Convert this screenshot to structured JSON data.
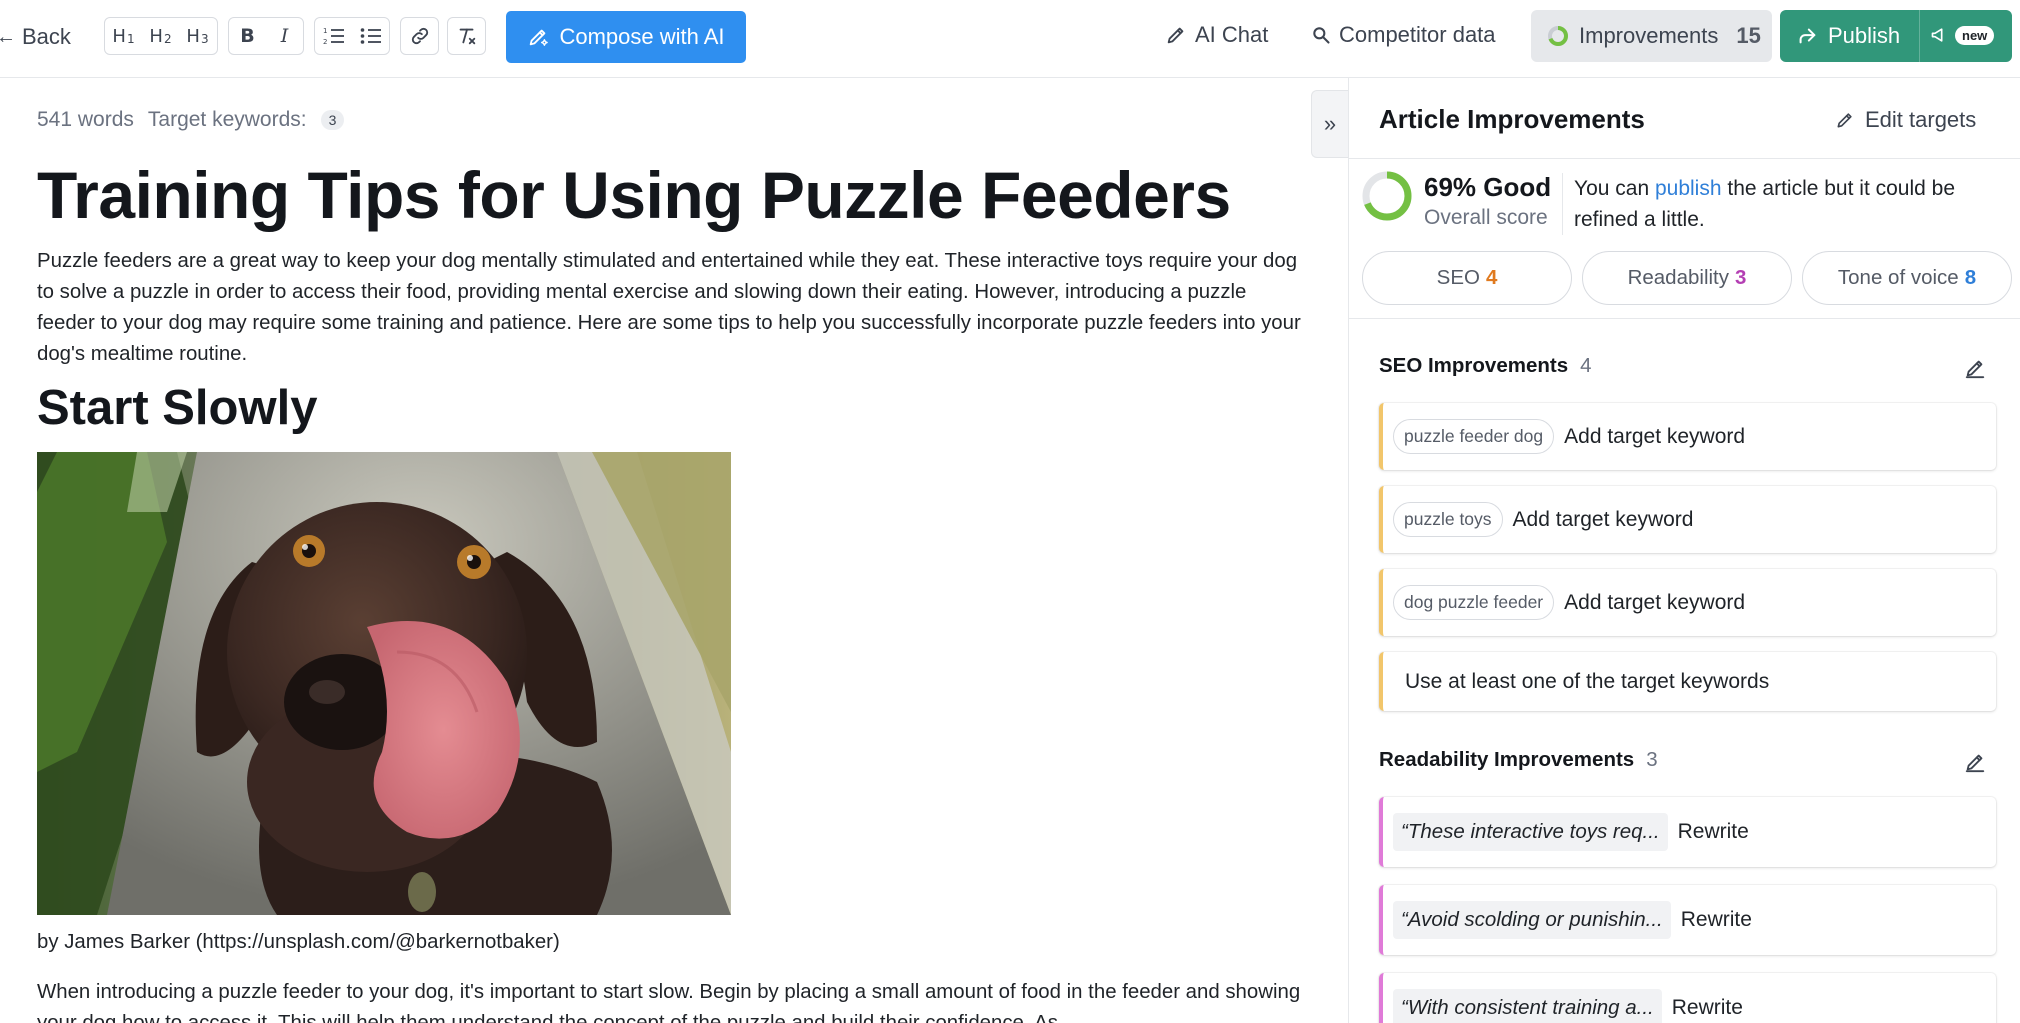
{
  "toolbar": {
    "back_label": "Back",
    "heading_buttons": [
      {
        "letter": "H",
        "level": "1"
      },
      {
        "letter": "H",
        "level": "2"
      },
      {
        "letter": "H",
        "level": "3"
      }
    ],
    "compose_label": "Compose with AI",
    "ai_chat_label": "AI Chat",
    "competitor_label": "Competitor data",
    "improvements_label": "Improvements",
    "improvements_count": "15",
    "publish_label": "Publish",
    "new_badge": "new",
    "colors": {
      "compose": "#2f8ff0",
      "publish": "#31977a"
    }
  },
  "editor": {
    "word_count": "541 words",
    "target_keywords_label": "Target keywords:",
    "target_keywords_count": "3",
    "title": "Training Tips for Using Puzzle Feeders",
    "intro": "Puzzle feeders are a great way to keep your dog mentally stimulated and entertained while they eat. These interactive toys require your dog to solve a puzzle in order to access their food, providing mental exercise and slowing down their eating. However, introducing a puzzle feeder to your dog may require some training and patience. Here are some tips to help you successfully incorporate puzzle feeders into your dog's mealtime routine.",
    "section_heading": "Start Slowly",
    "image_caption": "by James Barker (https://unsplash.com/@barkernotbaker)",
    "paragraph_2": "When introducing a puzzle feeder to your dog, it's important to start slow. Begin by placing a small amount of food in the feeder and showing your dog how to access it. This will help them understand the concept of the puzzle and build their confidence. As"
  },
  "panel": {
    "title": "Article Improvements",
    "edit_targets_label": "Edit targets",
    "score_text": "69% Good",
    "score_value": 0.69,
    "score_sub": "Overall score",
    "score_msg_before": "You can ",
    "score_msg_link": "publish",
    "score_msg_after": " the article but it could be refined a little.",
    "tabs": [
      {
        "label": "SEO",
        "count": "4",
        "color": "#e07a1f"
      },
      {
        "label": "Readability",
        "count": "3",
        "color": "#b43fb3"
      },
      {
        "label": "Tone of voice",
        "count": "8",
        "color": "#2f7fd8"
      }
    ],
    "seo_section": {
      "title": "SEO Improvements",
      "count": "4",
      "items": [
        {
          "keyword": "puzzle feeder dog",
          "action": "Add target keyword"
        },
        {
          "keyword": "puzzle toys",
          "action": "Add target keyword"
        },
        {
          "keyword": "dog puzzle feeder",
          "action": "Add target keyword"
        },
        {
          "keyword": "",
          "action": "Use at least one of the target keywords"
        }
      ]
    },
    "readability_section": {
      "title": "Readability Improvements",
      "count": "3",
      "items": [
        {
          "quote": "“These interactive toys req...",
          "action": "Rewrite"
        },
        {
          "quote": "“Avoid scolding or punishin...",
          "action": "Rewrite"
        },
        {
          "quote": "“With consistent training a...",
          "action": "Rewrite"
        }
      ]
    }
  }
}
